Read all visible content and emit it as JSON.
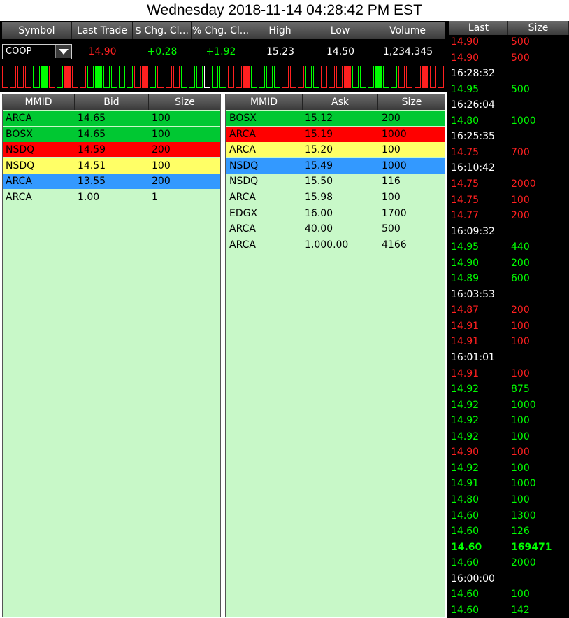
{
  "datetime": "Wednesday 2018-11-14 04:28:42 PM EST",
  "colors": {
    "up": "#00ff00",
    "down": "#ff2020",
    "bid_l1": "#00c832",
    "bid_l2": "#ff0000",
    "bid_l3": "#ffff66",
    "bid_l4": "#3399ff",
    "book_bg": "#c8f8c8"
  },
  "quote": {
    "headers": [
      "Symbol",
      "Last Trade",
      "$ Chg. Cl...",
      "% Chg. Cl...",
      "High",
      "Low",
      "Volume"
    ],
    "symbol": "COOP",
    "last_trade": "14.90",
    "dollar_change": "+0.28",
    "percent_change": "+1.92",
    "high": "15.23",
    "low": "14.50",
    "volume": "1,234,345"
  },
  "tick_bar": [
    "r",
    "r",
    "r",
    "r",
    "g",
    "G",
    "r",
    "g",
    "R",
    "r",
    "r",
    "g",
    "G",
    "g",
    "g",
    "g",
    "g",
    "r",
    "R",
    "g",
    "r",
    "r",
    "r",
    "g",
    "g",
    "g",
    "w",
    "g",
    "g",
    "r",
    "r",
    "R",
    "g",
    "g",
    "g",
    "g",
    "r",
    "r",
    "r",
    "g",
    "g",
    "r",
    "r",
    "r",
    "R",
    "g",
    "g",
    "g",
    "G",
    "g",
    "g",
    "r",
    "r",
    "r",
    "R",
    "r",
    "r"
  ],
  "bid_book": {
    "headers": [
      "MMID",
      "Bid",
      "Size"
    ],
    "rows": [
      {
        "mmid": "ARCA",
        "price": "14.65",
        "size": "100",
        "level": 1
      },
      {
        "mmid": "BOSX",
        "price": "14.65",
        "size": "100",
        "level": 1
      },
      {
        "mmid": "NSDQ",
        "price": "14.59",
        "size": "200",
        "level": 2
      },
      {
        "mmid": "NSDQ",
        "price": "14.51",
        "size": "100",
        "level": 3
      },
      {
        "mmid": "ARCA",
        "price": "13.55",
        "size": "200",
        "level": 4
      },
      {
        "mmid": "ARCA",
        "price": "1.00",
        "size": "1",
        "level": 0
      }
    ]
  },
  "ask_book": {
    "headers": [
      "MMID",
      "Ask",
      "Size"
    ],
    "rows": [
      {
        "mmid": "BOSX",
        "price": "15.12",
        "size": "200",
        "level": 1
      },
      {
        "mmid": "ARCA",
        "price": "15.19",
        "size": "1000",
        "level": 2
      },
      {
        "mmid": "ARCA",
        "price": "15.20",
        "size": "100",
        "level": 3
      },
      {
        "mmid": "NSDQ",
        "price": "15.49",
        "size": "1000",
        "level": 4
      },
      {
        "mmid": "NSDQ",
        "price": "15.50",
        "size": "116",
        "level": 0
      },
      {
        "mmid": "ARCA",
        "price": "15.98",
        "size": "100",
        "level": 0
      },
      {
        "mmid": "EDGX",
        "price": "16.00",
        "size": "1700",
        "level": 0
      },
      {
        "mmid": "ARCA",
        "price": "40.00",
        "size": "500",
        "level": 0
      },
      {
        "mmid": "ARCA",
        "price": "1,000.00",
        "size": "4166",
        "level": 0
      }
    ]
  },
  "time_sales": {
    "headers": [
      "Last",
      "Size"
    ],
    "rows": [
      {
        "kind": "trade",
        "price": "14.90",
        "size": "500",
        "dir": "down"
      },
      {
        "kind": "trade",
        "price": "14.90",
        "size": "500",
        "dir": "down"
      },
      {
        "kind": "time",
        "time": "16:28:32"
      },
      {
        "kind": "trade",
        "price": "14.95",
        "size": "500",
        "dir": "up"
      },
      {
        "kind": "time",
        "time": "16:26:04"
      },
      {
        "kind": "trade",
        "price": "14.80",
        "size": "1000",
        "dir": "up"
      },
      {
        "kind": "time",
        "time": "16:25:35"
      },
      {
        "kind": "trade",
        "price": "14.75",
        "size": "700",
        "dir": "down"
      },
      {
        "kind": "time",
        "time": "16:10:42"
      },
      {
        "kind": "trade",
        "price": "14.75",
        "size": "2000",
        "dir": "down"
      },
      {
        "kind": "trade",
        "price": "14.75",
        "size": "100",
        "dir": "down"
      },
      {
        "kind": "trade",
        "price": "14.77",
        "size": "200",
        "dir": "down"
      },
      {
        "kind": "time",
        "time": "16:09:32"
      },
      {
        "kind": "trade",
        "price": "14.95",
        "size": "440",
        "dir": "up"
      },
      {
        "kind": "trade",
        "price": "14.90",
        "size": "200",
        "dir": "up"
      },
      {
        "kind": "trade",
        "price": "14.89",
        "size": "600",
        "dir": "up"
      },
      {
        "kind": "time",
        "time": "16:03:53"
      },
      {
        "kind": "trade",
        "price": "14.87",
        "size": "200",
        "dir": "down"
      },
      {
        "kind": "trade",
        "price": "14.91",
        "size": "100",
        "dir": "down"
      },
      {
        "kind": "trade",
        "price": "14.91",
        "size": "100",
        "dir": "down"
      },
      {
        "kind": "time",
        "time": "16:01:01"
      },
      {
        "kind": "trade",
        "price": "14.91",
        "size": "100",
        "dir": "down"
      },
      {
        "kind": "trade",
        "price": "14.92",
        "size": "875",
        "dir": "up"
      },
      {
        "kind": "trade",
        "price": "14.92",
        "size": "1000",
        "dir": "up"
      },
      {
        "kind": "trade",
        "price": "14.92",
        "size": "100",
        "dir": "up"
      },
      {
        "kind": "trade",
        "price": "14.92",
        "size": "100",
        "dir": "up"
      },
      {
        "kind": "trade",
        "price": "14.90",
        "size": "100",
        "dir": "down"
      },
      {
        "kind": "trade",
        "price": "14.92",
        "size": "100",
        "dir": "up"
      },
      {
        "kind": "trade",
        "price": "14.91",
        "size": "1000",
        "dir": "up"
      },
      {
        "kind": "trade",
        "price": "14.80",
        "size": "100",
        "dir": "up"
      },
      {
        "kind": "trade",
        "price": "14.60",
        "size": "1300",
        "dir": "up"
      },
      {
        "kind": "trade",
        "price": "14.60",
        "size": "126",
        "dir": "up"
      },
      {
        "kind": "trade",
        "price": "14.60",
        "size": "169471",
        "dir": "up",
        "bold": true
      },
      {
        "kind": "trade",
        "price": "14.60",
        "size": "2000",
        "dir": "up"
      },
      {
        "kind": "time",
        "time": "16:00:00"
      },
      {
        "kind": "trade",
        "price": "14.60",
        "size": "100",
        "dir": "up"
      },
      {
        "kind": "trade",
        "price": "14.60",
        "size": "142",
        "dir": "up"
      }
    ]
  }
}
